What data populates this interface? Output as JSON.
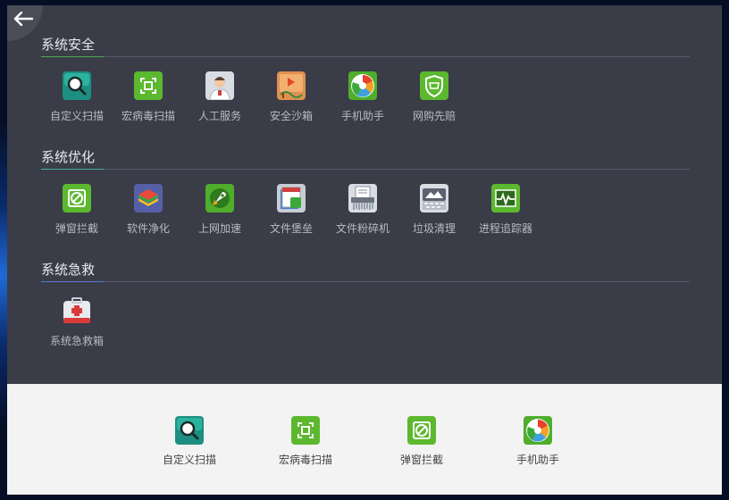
{
  "sections": [
    {
      "title": "系统安全",
      "items": [
        {
          "label": "自定义扫描",
          "icon": "custom-scan-icon"
        },
        {
          "label": "宏病毒扫描",
          "icon": "macro-virus-scan-icon"
        },
        {
          "label": "人工服务",
          "icon": "manual-service-icon"
        },
        {
          "label": "安全沙箱",
          "icon": "sandbox-icon"
        },
        {
          "label": "手机助手",
          "icon": "phone-assistant-icon"
        },
        {
          "label": "网购先赔",
          "icon": "shopping-shield-icon"
        }
      ]
    },
    {
      "title": "系统优化",
      "items": [
        {
          "label": "弹窗拦截",
          "icon": "popup-block-icon"
        },
        {
          "label": "软件净化",
          "icon": "software-purify-icon"
        },
        {
          "label": "上网加速",
          "icon": "net-accelerate-icon"
        },
        {
          "label": "文件堡垒",
          "icon": "file-fortress-icon"
        },
        {
          "label": "文件粉碎机",
          "icon": "file-shredder-icon"
        },
        {
          "label": "垃圾清理",
          "icon": "junk-clean-icon"
        },
        {
          "label": "进程追踪器",
          "icon": "process-tracker-icon"
        }
      ]
    },
    {
      "title": "系统急救",
      "items": [
        {
          "label": "系统急救箱",
          "icon": "first-aid-icon"
        }
      ]
    }
  ],
  "quick_bar": [
    {
      "label": "自定义扫描",
      "icon": "custom-scan-icon"
    },
    {
      "label": "宏病毒扫描",
      "icon": "macro-virus-scan-icon"
    },
    {
      "label": "弹窗拦截",
      "icon": "popup-block-icon"
    },
    {
      "label": "手机助手",
      "icon": "phone-assistant-icon"
    }
  ],
  "colors": {
    "panel_bg": "#3a3c48",
    "bottom_bg": "#f2f3f2",
    "green_icon": "#5cb82e",
    "teal_icon": "#1f9a88"
  }
}
